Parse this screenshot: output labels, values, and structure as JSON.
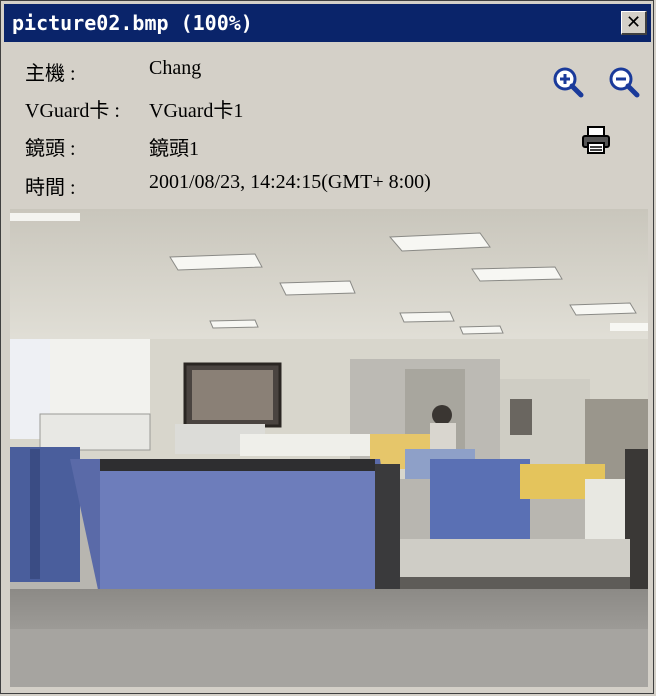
{
  "window": {
    "title": "picture02.bmp (100%)",
    "close_label": "✕"
  },
  "info": {
    "rows": [
      {
        "label": "主機 :",
        "value": "Chang"
      },
      {
        "label": "VGuard卡 :",
        "value": "VGuard卡1"
      },
      {
        "label": "鏡頭 :",
        "value": "鏡頭1"
      },
      {
        "label": "時間 :",
        "value": "2001/08/23, 14:24:15(GMT+ 8:00)"
      }
    ]
  },
  "toolbar": {
    "zoom_in_icon": "zoom-in-icon",
    "zoom_out_icon": "zoom-out-icon",
    "print_icon": "printer-icon"
  },
  "colors": {
    "titlebar": "#0a246a",
    "window_bg": "#d4d0c8",
    "icon_blue": "#1a3a9a"
  },
  "image": {
    "description_icon": "office-camera-snapshot"
  }
}
